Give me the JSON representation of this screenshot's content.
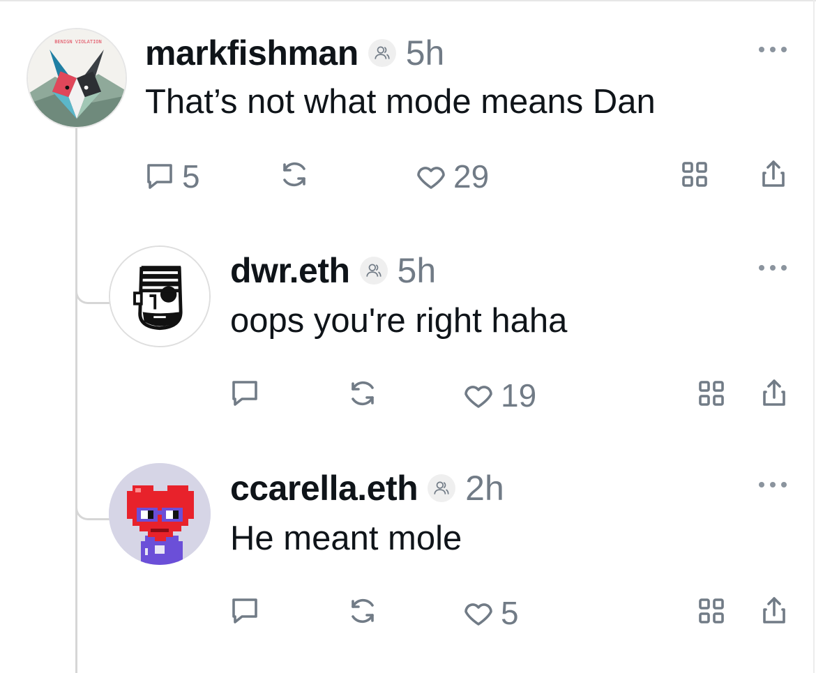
{
  "posts": [
    {
      "username": "markfishman",
      "time": "5h",
      "text": "That’s not what mode means Dan",
      "avatar": {
        "icon": "fox-logo-avatar",
        "label": "BENIGN VIOLATION"
      },
      "replies_count": "5",
      "recasts_count": "",
      "likes_count": "29"
    },
    {
      "username": "dwr.eth",
      "time": "5h",
      "text": "oops you're right haha",
      "avatar": {
        "icon": "pirate-face-avatar"
      },
      "replies_count": "",
      "recasts_count": "",
      "likes_count": "19"
    },
    {
      "username": "ccarella.eth",
      "time": "2h",
      "text": "He meant mole",
      "avatar": {
        "icon": "pixel-heart-avatar"
      },
      "replies_count": "",
      "recasts_count": "",
      "likes_count": "5"
    }
  ],
  "colors": {
    "muted": "#717b86",
    "text": "#0f1419",
    "thread": "#d6d6d6"
  }
}
